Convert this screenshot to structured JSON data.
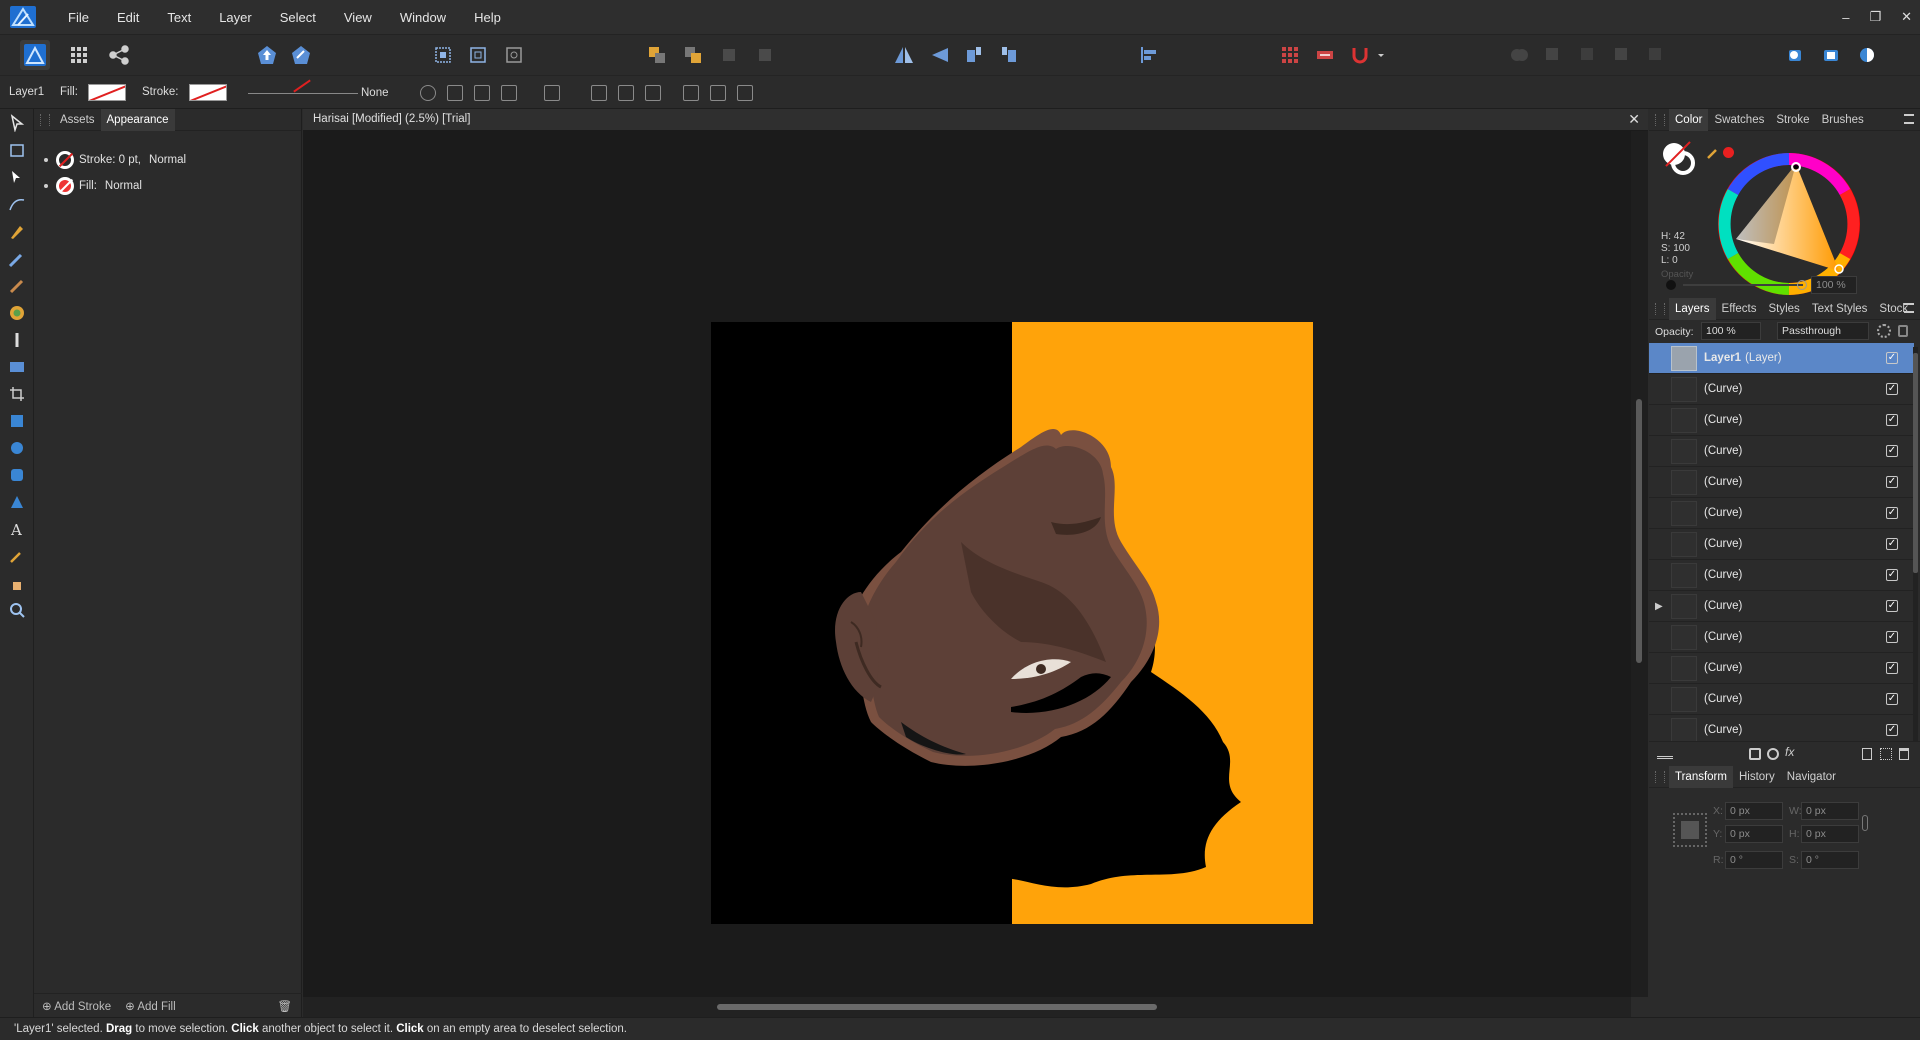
{
  "menu": {
    "items": [
      "File",
      "Edit",
      "Text",
      "Layer",
      "Select",
      "View",
      "Window",
      "Help"
    ],
    "window_controls": [
      "–",
      "❐",
      "✕"
    ]
  },
  "context": {
    "layer_name": "Layer1",
    "fill_label": "Fill:",
    "stroke_label": "Stroke:",
    "stroke_value": "None"
  },
  "left_panel": {
    "tabs": [
      "Assets",
      "Appearance"
    ],
    "active_tab": "Appearance",
    "rows": [
      {
        "label": "Stroke: 0 pt,",
        "mode": "Normal"
      },
      {
        "label": "Fill:",
        "mode": "Normal"
      }
    ],
    "add_stroke": "Add Stroke",
    "add_fill": "Add Fill"
  },
  "document": {
    "title": "Harisai [Modified] (2.5%) [Trial]",
    "close": "✕",
    "colors": {
      "left": "#000000",
      "right": "#ffa30a",
      "skin": "#5d4037",
      "skin_dark": "#4a322a",
      "outline": "#7a5040",
      "hair": "#000000"
    }
  },
  "color_panel": {
    "tabs": [
      "Color",
      "Swatches",
      "Stroke",
      "Brushes"
    ],
    "active_tab": "Color",
    "h": "H: 42",
    "s": "S: 100",
    "l": "L: 0",
    "opacity_label": "Opacity",
    "opacity_value": "100 %",
    "current_color": "#ffa30a"
  },
  "layers_panel": {
    "tabs": [
      "Layers",
      "Effects",
      "Styles",
      "Text Styles",
      "Stock"
    ],
    "active_tab": "Layers",
    "opacity_label": "Opacity:",
    "opacity_value": "100 %",
    "blend_mode": "Passthrough",
    "rows": [
      {
        "name": "Layer1",
        "suffix": "(Layer)",
        "selected": true,
        "expand": "",
        "checked": true
      },
      {
        "name": "(Curve)",
        "suffix": "",
        "selected": false,
        "expand": "",
        "checked": true
      },
      {
        "name": "(Curve)",
        "suffix": "",
        "selected": false,
        "expand": "",
        "checked": true
      },
      {
        "name": "(Curve)",
        "suffix": "",
        "selected": false,
        "expand": "",
        "checked": true
      },
      {
        "name": "(Curve)",
        "suffix": "",
        "selected": false,
        "expand": "",
        "checked": true
      },
      {
        "name": "(Curve)",
        "suffix": "",
        "selected": false,
        "expand": "",
        "checked": true
      },
      {
        "name": "(Curve)",
        "suffix": "",
        "selected": false,
        "expand": "",
        "checked": true
      },
      {
        "name": "(Curve)",
        "suffix": "",
        "selected": false,
        "expand": "",
        "checked": true
      },
      {
        "name": "(Curve)",
        "suffix": "",
        "selected": false,
        "expand": "▶",
        "checked": true
      },
      {
        "name": "(Curve)",
        "suffix": "",
        "selected": false,
        "expand": "",
        "checked": true
      },
      {
        "name": "(Curve)",
        "suffix": "",
        "selected": false,
        "expand": "",
        "checked": true
      },
      {
        "name": "(Curve)",
        "suffix": "",
        "selected": false,
        "expand": "",
        "checked": true
      },
      {
        "name": "(Curve)",
        "suffix": "",
        "selected": false,
        "expand": "",
        "checked": true
      },
      {
        "name": "(Curve)",
        "suffix": "",
        "selected": false,
        "expand": "▶",
        "checked": true
      }
    ]
  },
  "transform_panel": {
    "tabs": [
      "Transform",
      "History",
      "Navigator"
    ],
    "active_tab": "Transform",
    "x_label": "X:",
    "x": "0 px",
    "y_label": "Y:",
    "y": "0 px",
    "w_label": "W:",
    "w": "0 px",
    "h_label": "H:",
    "h": "0 px",
    "r_label": "R:",
    "r": "0 °",
    "s_label": "S:",
    "s": "0 °"
  },
  "status": {
    "part1": "'Layer1' selected. ",
    "b1": "Drag",
    "part2": " to move selection. ",
    "b2": "Click",
    "part3": " another object to select it. ",
    "b3": "Click",
    "part4": " on an empty area to deselect selection."
  }
}
